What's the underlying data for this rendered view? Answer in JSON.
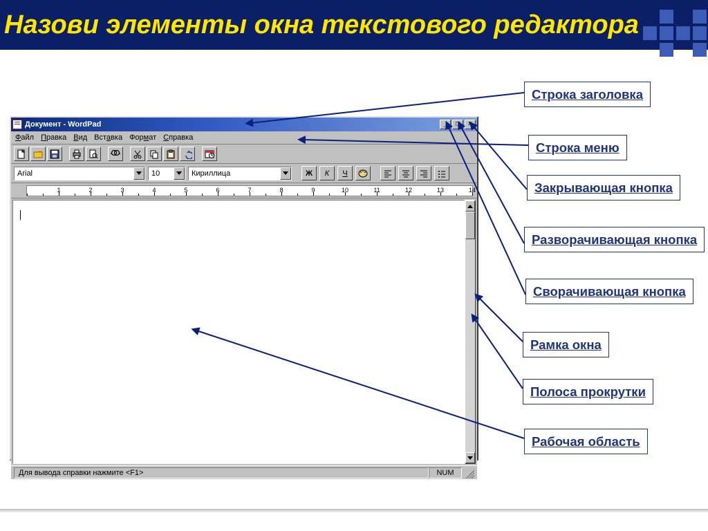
{
  "slide": {
    "title": "Назови элементы окна текстового редактора"
  },
  "window": {
    "title": "Документ - WordPad",
    "menu": {
      "file": "Файл",
      "edit": "Правка",
      "view": "Вид",
      "insert": "Вставка",
      "format": "Формат",
      "help": "Справка"
    },
    "format": {
      "font": "Arial",
      "size": "10",
      "script": "Кириллица",
      "bold": "Ж",
      "italic": "К",
      "underline": "Ч"
    },
    "status": {
      "hint": "Для вывода справки нажмите <F1>",
      "num": "NUM"
    },
    "ruler_max": 14
  },
  "callouts": {
    "c1": "Строка заголовка",
    "c2": "Строка меню",
    "c3": "Закрывающая кнопка",
    "c4": "Разворачивающая кнопка",
    "c5": "Сворачивающая кнопка",
    "c6": "Рамка окна",
    "c7": "Полоса прокрутки",
    "c8": "Рабочая область"
  }
}
